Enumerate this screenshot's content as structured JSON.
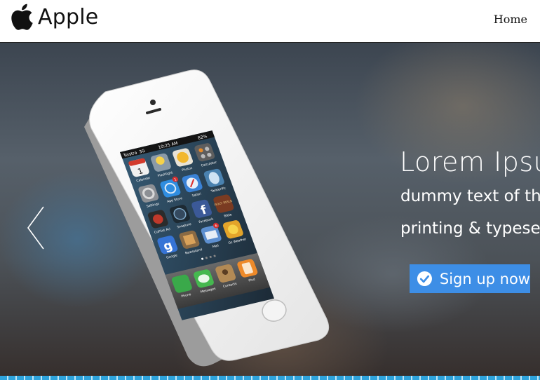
{
  "header": {
    "brand_name": "Apple",
    "logo_icon": "apple-logo-icon",
    "nav": [
      {
        "label": "Home"
      }
    ]
  },
  "hero": {
    "title": "Lorem Ipsum",
    "line1": "dummy text of the",
    "line2": "printing & typesetting",
    "cta_label": "Sign up now",
    "cta_icon": "check-circle-icon",
    "prev_icon": "chevron-left-icon",
    "colors": {
      "cta_background": "#3d8ee6",
      "accent_bar": "#2ea3dc"
    }
  },
  "phone_screen": {
    "carrier": "Telstra",
    "network": "3G",
    "time": "10:25 AM",
    "battery": "82%",
    "apps": [
      {
        "label": "Calendar",
        "text": "1"
      },
      {
        "label": "Flashlight"
      },
      {
        "label": "Photos"
      },
      {
        "label": "Calculator"
      },
      {
        "label": "Settings"
      },
      {
        "label": "App Store",
        "badge": "1"
      },
      {
        "label": "Safari"
      },
      {
        "label": "Twitterific"
      },
      {
        "label": "CoPilot AU"
      },
      {
        "label": "Snapture"
      },
      {
        "label": "Facebook"
      },
      {
        "label": "Bible",
        "text": "HOLY BIBLE"
      },
      {
        "label": "Google"
      },
      {
        "label": "Newsstand"
      },
      {
        "label": "Mail",
        "badge": "6"
      },
      {
        "label": "Oz Weather"
      }
    ],
    "dock": [
      {
        "label": "Phone"
      },
      {
        "label": "Messages"
      },
      {
        "label": "Contacts"
      },
      {
        "label": "iPod"
      }
    ]
  }
}
